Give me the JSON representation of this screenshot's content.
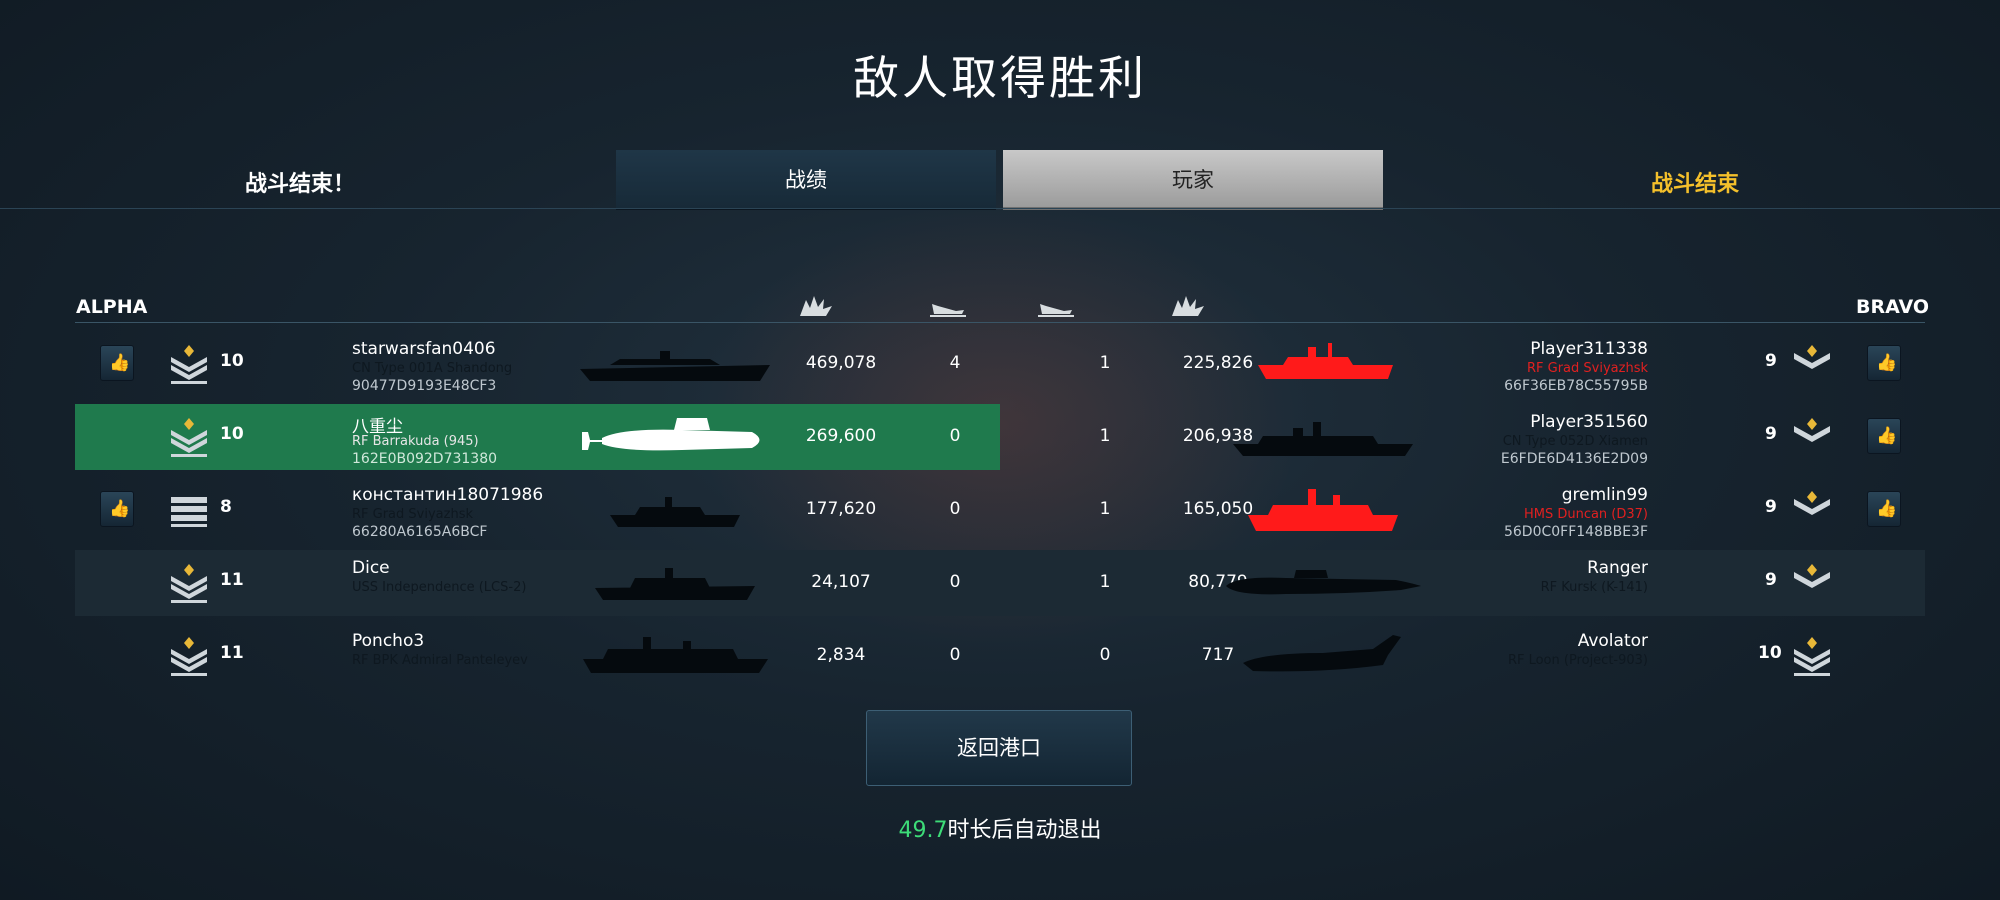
{
  "title": "敌人取得胜利",
  "header": {
    "left_label": "战斗结束！",
    "right_label": "战斗结束",
    "tabs": [
      "战绩",
      "玩家"
    ]
  },
  "teams": {
    "left": "ALPHA",
    "right": "BRAVO"
  },
  "rows": [
    {
      "left": {
        "rank": "10",
        "name": "starwarsfan0406",
        "ship": "CN Type 001A Shandong",
        "id": "90477D9193E48CF3",
        "damage": "469,078",
        "kills": "4"
      },
      "right": {
        "rank": "9",
        "name": "Player311338",
        "ship": "RF Grad Sviyazhsk",
        "id": "66F36EB78C55795B",
        "damage": "225,826",
        "kills": "1"
      }
    },
    {
      "left": {
        "rank": "10",
        "name": "八重尘",
        "ship": "RF Barrakuda (945)",
        "id": "162E0B092D731380",
        "damage": "269,600",
        "kills": "0"
      },
      "right": {
        "rank": "9",
        "name": "Player351560",
        "ship": "CN Type 052D Xiamen",
        "id": "E6FDE6D4136E2D09",
        "damage": "206,938",
        "kills": "1"
      }
    },
    {
      "left": {
        "rank": "8",
        "name": "константин18071986",
        "ship": "RF Grad Sviyazhsk",
        "id": "66280A6165A6BCF",
        "damage": "177,620",
        "kills": "0"
      },
      "right": {
        "rank": "9",
        "name": "gremlin99",
        "ship": "HMS Duncan (D37)",
        "id": "56D0C0FF148BBE3F",
        "damage": "165,050",
        "kills": "1"
      }
    },
    {
      "left": {
        "rank": "11",
        "name": "Dice",
        "ship": "USS Independence (LCS-2)",
        "id": "",
        "damage": "24,107",
        "kills": "0"
      },
      "right": {
        "rank": "9",
        "name": "Ranger",
        "ship": "RF Kursk (K-141)",
        "id": "",
        "damage": "80,779",
        "kills": "1"
      }
    },
    {
      "left": {
        "rank": "11",
        "name": "Poncho3",
        "ship": "RF BPK Admiral Panteleyev",
        "id": "",
        "damage": "2,834",
        "kills": "0"
      },
      "right": {
        "rank": "10",
        "name": "Avolator",
        "ship": "RF Loon (Project-903)",
        "id": "",
        "damage": "717",
        "kills": "0"
      }
    }
  ],
  "footer": {
    "return_button": "返回港口",
    "countdown": "49.7",
    "auto_exit_text": "时长后自动退出"
  },
  "colors": {
    "highlight_row": "#1f7a4d",
    "alt_row": "#1c2a34",
    "accent_gold": "#f4c02b",
    "enemy_red": "#ff1a1a",
    "countdown_green": "#3ddc78"
  },
  "icons": {
    "damage_column": "explosion-icon",
    "kills_column": "sinking-ship-icon",
    "like": "thumbs-up-icon",
    "rank": "chevron-rank-icon"
  }
}
